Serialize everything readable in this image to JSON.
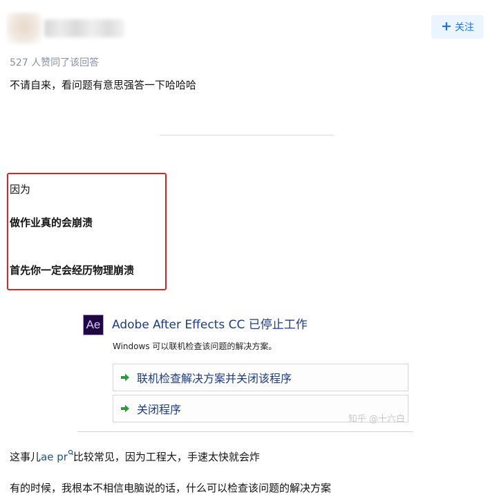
{
  "header": {
    "follow_label": "关注",
    "follow_icon": "plus-icon"
  },
  "answer": {
    "upvotes": "527 人赞同了该回答",
    "intro": "不请自来，看问题有意思强答一下哈哈哈",
    "highlight": {
      "line1": "因为",
      "line2": "做作业真的会崩溃",
      "line3": "首先你一定会经历物理崩溃"
    },
    "dialog": {
      "app_icon_text": "Ae",
      "title": "Adobe After Effects CC 已停止工作",
      "subtitle": "Windows 可以联机检查该问题的解决方案。",
      "options": [
        {
          "label": "联机检查解决方案并关闭该程序"
        },
        {
          "label": "关闭程序"
        }
      ],
      "watermark": "知乎 @十六白"
    },
    "para2": {
      "before": "这事儿",
      "link1": "ae",
      "space": " ",
      "link2": "pr",
      "after": "比较常见，因为工程大，手速太快就会炸"
    },
    "para3_partial": "有的时候，我根本不相信电脑说的话，什么可以检查该问题的解决方案"
  },
  "colors": {
    "accent": "#1772f6",
    "highlight_border": "#e02020",
    "meta_text": "#8590a6"
  }
}
